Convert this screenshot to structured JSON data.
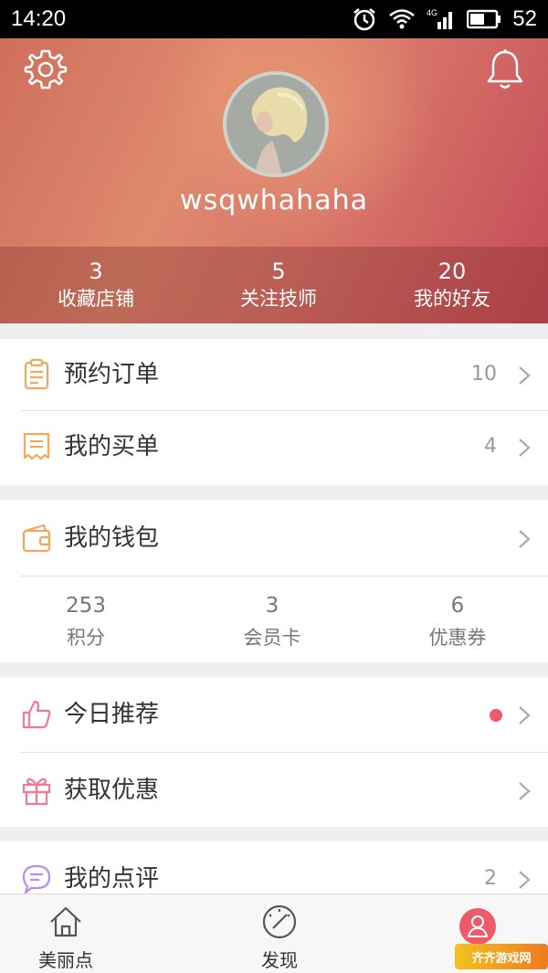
{
  "status_bar": {
    "time": "14:20",
    "network": "4G",
    "battery": "52",
    "icons": [
      "alarm-icon",
      "wifi-icon",
      "signal-icon",
      "battery-icon"
    ]
  },
  "header": {
    "username": "wsqwhahaha",
    "settings_icon": "gear-icon",
    "notification_icon": "bell-icon"
  },
  "stats": [
    {
      "value": "3",
      "label": "收藏店铺"
    },
    {
      "value": "5",
      "label": "关注技师"
    },
    {
      "value": "20",
      "label": "我的好友"
    }
  ],
  "orders": [
    {
      "label": "预约订单",
      "count": "10",
      "icon": "clipboard-icon"
    },
    {
      "label": "我的买单",
      "count": "4",
      "icon": "receipt-icon"
    }
  ],
  "wallet": {
    "label": "我的钱包",
    "icon": "wallet-icon",
    "items": [
      {
        "value": "253",
        "label": "积分"
      },
      {
        "value": "3",
        "label": "会员卡"
      },
      {
        "value": "6",
        "label": "优惠券"
      }
    ]
  },
  "promos": [
    {
      "label": "今日推荐",
      "icon": "thumbs-up-icon",
      "has_dot": true
    },
    {
      "label": "获取优惠",
      "icon": "gift-icon"
    }
  ],
  "reviews": {
    "label": "我的点评",
    "count": "2",
    "icon": "chat-icon"
  },
  "bottom_nav": [
    {
      "label": "美丽点",
      "icon": "home-icon"
    },
    {
      "label": "发现",
      "icon": "compass-icon"
    },
    {
      "label": "",
      "icon": "profile-icon",
      "active": true
    }
  ],
  "watermark": "齐齐游戏网",
  "colors": {
    "accent": "#ef5a6a",
    "header_start": "#cf6f5c",
    "header_end": "#c44a56",
    "icon_orange": "#f0a85a",
    "icon_pink": "#f07a8e",
    "icon_purple": "#b58cf0"
  }
}
